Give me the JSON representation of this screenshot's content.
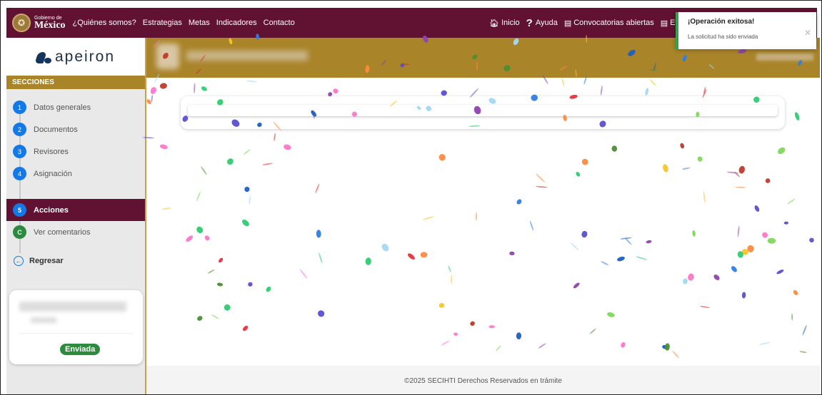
{
  "topnav": {
    "gob_small": "Gobierno de",
    "gob_big": "México",
    "links": [
      "¿Quiénes somos?",
      "Estrategias",
      "Metas",
      "Indicadores",
      "Contacto"
    ],
    "right": {
      "inicio": "Inicio",
      "ayuda": "Ayuda",
      "convocatorias": "Convocatorias abiertas",
      "evaluac": "Evaluac"
    }
  },
  "sidebar": {
    "brand": "apeiron",
    "sections_title": "SECCIONES",
    "steps": [
      {
        "num": "1",
        "label": "Datos generales"
      },
      {
        "num": "2",
        "label": "Documentos"
      },
      {
        "num": "3",
        "label": "Revisores"
      },
      {
        "num": "4",
        "label": "Asignación"
      }
    ],
    "active_step": {
      "num": "5",
      "label": "Acciones"
    },
    "comments_step": {
      "num": "C",
      "label": "Ver comentarios"
    },
    "back_label": "Regresar",
    "status_badge": "Enviada"
  },
  "footer": {
    "text": "©2025 SECIHTI Derechos Reservados en trámite"
  },
  "toast": {
    "title": "¡Operación exitosa!",
    "message": "La solicitud ha sido enviada",
    "close_symbol": "✕"
  },
  "colors": {
    "nav": "#611232",
    "gold": "#a98429",
    "step_blue": "#1479e6",
    "success_green": "#2e8b3e"
  }
}
